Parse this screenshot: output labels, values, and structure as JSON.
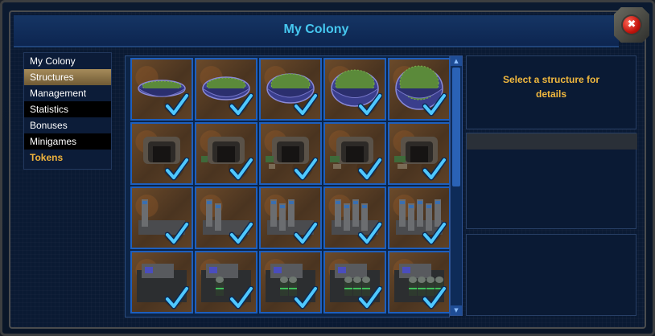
{
  "window": {
    "title": "My Colony"
  },
  "close_icon": "close-x-icon",
  "menu": {
    "items": [
      {
        "label": "My Colony",
        "state": "normal"
      },
      {
        "label": "Structures",
        "state": "selected"
      },
      {
        "label": "Management",
        "state": "normal"
      },
      {
        "label": "Statistics",
        "state": "alt"
      },
      {
        "label": "Bonuses",
        "state": "normal"
      },
      {
        "label": "Minigames",
        "state": "alt"
      },
      {
        "label": "Tokens",
        "state": "gold"
      }
    ]
  },
  "details": {
    "prompt": "Select a structure for details"
  },
  "structures": {
    "rows": [
      {
        "kind": "dome",
        "count": 5,
        "owned": [
          true,
          true,
          true,
          true,
          true
        ]
      },
      {
        "kind": "bunker",
        "count": 5,
        "owned": [
          true,
          true,
          true,
          true,
          true
        ]
      },
      {
        "kind": "refinery",
        "count": 5,
        "owned": [
          true,
          true,
          true,
          true,
          true
        ]
      },
      {
        "kind": "silo-plant",
        "count": 5,
        "owned": [
          true,
          true,
          true,
          true,
          true
        ]
      }
    ]
  },
  "colors": {
    "title": "#46c8f0",
    "detail_text": "#f2b93e",
    "tile_border": "#1d5fbf",
    "checkmark": "#4fc8ff",
    "menu_selected": "#a68b5a",
    "menu_gold": "#f0b43c"
  }
}
